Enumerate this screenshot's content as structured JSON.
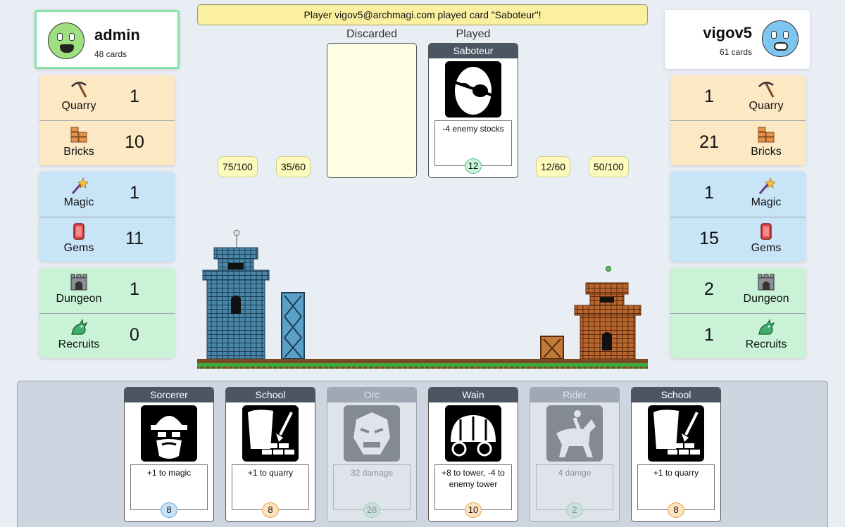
{
  "message": "Player vigov5@archmagi.com played card \"Saboteur\"!",
  "left_player": {
    "name": "admin",
    "cards": "48 cards",
    "avatar_icon": "green-monster-avatar-icon",
    "resources": {
      "quarry": {
        "label": "Quarry",
        "value": "1",
        "icon": "pickaxe-icon"
      },
      "bricks": {
        "label": "Bricks",
        "value": "10",
        "icon": "bricks-icon"
      },
      "magic": {
        "label": "Magic",
        "value": "1",
        "icon": "wand-icon"
      },
      "gems": {
        "label": "Gems",
        "value": "11",
        "icon": "gem-icon"
      },
      "dungeon": {
        "label": "Dungeon",
        "value": "1",
        "icon": "dungeon-icon"
      },
      "recruits": {
        "label": "Recruits",
        "value": "0",
        "icon": "dragon-icon"
      }
    },
    "tower": "75/100",
    "wall": "35/60"
  },
  "right_player": {
    "name": "vigov5",
    "cards": "61 cards",
    "avatar_icon": "blue-monster-avatar-icon",
    "resources": {
      "quarry": {
        "label": "Quarry",
        "value": "1",
        "icon": "pickaxe-icon"
      },
      "bricks": {
        "label": "Bricks",
        "value": "21",
        "icon": "bricks-icon"
      },
      "magic": {
        "label": "Magic",
        "value": "1",
        "icon": "wand-icon"
      },
      "gems": {
        "label": "Gems",
        "value": "15",
        "icon": "gem-icon"
      },
      "dungeon": {
        "label": "Dungeon",
        "value": "2",
        "icon": "dungeon-icon"
      },
      "recruits": {
        "label": "Recruits",
        "value": "1",
        "icon": "dragon-icon"
      }
    },
    "wall": "12/60",
    "tower": "50/100"
  },
  "piles": {
    "discarded_label": "Discarded",
    "played_label": "Played"
  },
  "played_card": {
    "title": "Saboteur",
    "desc": "-4 enemy stocks",
    "cost": "12",
    "cost_type": "green",
    "icon": "eyepatch-icon"
  },
  "hand": [
    {
      "title": "Sorcerer",
      "desc": "+1 to magic",
      "cost": "8",
      "cost_type": "blue",
      "icon": "wizard-icon",
      "disabled": false
    },
    {
      "title": "School",
      "desc": "+1 to quarry",
      "cost": "8",
      "cost_type": "orange",
      "icon": "school-icon",
      "disabled": false
    },
    {
      "title": "Orc",
      "desc": "32 damage",
      "cost": "28",
      "cost_type": "green",
      "icon": "orc-icon",
      "disabled": true
    },
    {
      "title": "Wain",
      "desc": "+8 to tower, -4 to enemy tower",
      "cost": "10",
      "cost_type": "orange",
      "icon": "wagon-icon",
      "disabled": false
    },
    {
      "title": "Rider",
      "desc": "4 damge",
      "cost": "2",
      "cost_type": "green",
      "icon": "horse-rider-icon",
      "disabled": true
    },
    {
      "title": "School",
      "desc": "+1 to quarry",
      "cost": "8",
      "cost_type": "orange",
      "icon": "school-icon",
      "disabled": false
    }
  ],
  "colors": {
    "quarry": "#fde8c4",
    "magic": "#c8e5f8",
    "dungeon": "#c9f2d6",
    "message_bg": "#faf0a0",
    "card_header": "#4b5563"
  }
}
